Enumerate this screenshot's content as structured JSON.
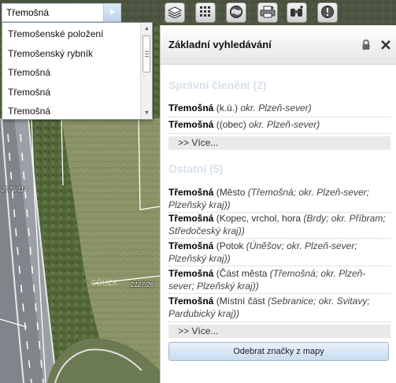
{
  "search": {
    "value": "Třemošná"
  },
  "toolbar": {
    "buttons": [
      {
        "name": "layers-icon"
      },
      {
        "name": "grid-icon"
      },
      {
        "name": "globe-icon"
      },
      {
        "name": "print-icon"
      },
      {
        "name": "binoculars-icon"
      },
      {
        "name": "info-icon"
      }
    ]
  },
  "suggestions": [
    "Třemošenské položení",
    "Třemošenský rybník",
    "Třemošná",
    "Třemošná",
    "Třemošná"
  ],
  "map": {
    "parcel_labels": [
      "2576/114",
      "2127/26"
    ],
    "watermark": "©ČÚZK"
  },
  "panel": {
    "title": "Základní vyhledávání",
    "sections": [
      {
        "heading": "Správní členění  (2)",
        "results": [
          {
            "name": "Třemošná",
            "type": " (k.ú.) ",
            "location": "okr. Plzeň-sever)"
          },
          {
            "name": "Třemošná",
            "type": " ((obec) ",
            "location": "okr. Plzeň-sever)"
          }
        ],
        "more": ">> Více..."
      },
      {
        "heading": "Ostatní  (5)",
        "results": [
          {
            "name": "Třemošná",
            "type": " (Město ",
            "location": "(Třemošná; okr. Plzeň-sever; Plzeňský kraj))"
          },
          {
            "name": "Třemošná",
            "type": " (Kopec, vrchol, hora ",
            "location": "(Brdy; okr. Příbram; Středočeský kraj))"
          },
          {
            "name": "Třemošná",
            "type": " (Potok ",
            "location": "(Úněšov; okr. Plzeň-sever; Plzeňský kraj))"
          },
          {
            "name": "Třemošná",
            "type": " (Část města ",
            "location": "(Třemošná; okr. Plzeň-sever; Plzeňský kraj))"
          },
          {
            "name": "Třemošná",
            "type": " (Místní část ",
            "location": "(Sebranice; okr. Svitavy; Pardubický kraj))"
          }
        ],
        "more": ">> Více..."
      }
    ],
    "remove_markers_label": "Odebrat značky z mapy"
  }
}
